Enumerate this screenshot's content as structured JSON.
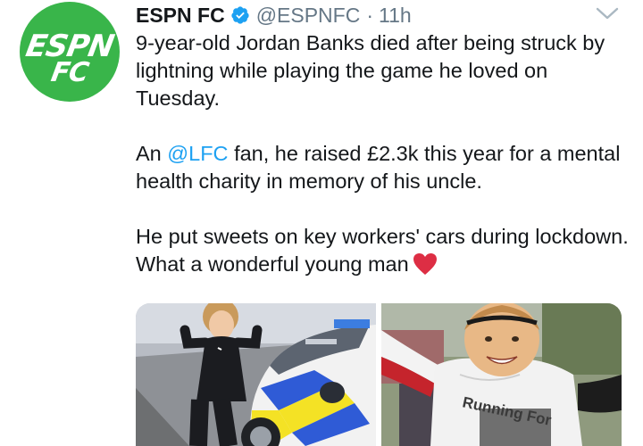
{
  "tweet": {
    "avatar_text_line1": "ESPN",
    "avatar_text_line2": "FC",
    "display_name": "ESPN FC",
    "handle": "@ESPNFC",
    "separator": "·",
    "time": "11h",
    "paragraph1": "9-year-old Jordan Banks died after being struck by lightning while playing the game he loved on Tuesday.",
    "paragraph2_prefix": "An ",
    "paragraph2_mention": "@LFC",
    "paragraph2_suffix": " fan, he raised £2.3k this year for a mental health charity in memory of his uncle.",
    "paragraph3": "He put sweets on key workers' cars during lockdown. What a wonderful young man",
    "photo2_caption": "Running For"
  },
  "colors": {
    "brand_green": "#39b54a",
    "link_blue": "#1da1f2",
    "verified_blue": "#1da1f2",
    "muted_gray": "#657786",
    "heart_red": "#e0245e"
  },
  "icons": {
    "verified": "verified-badge-icon",
    "caret": "chevron-down-icon",
    "emoji": "red-heart-icon"
  }
}
